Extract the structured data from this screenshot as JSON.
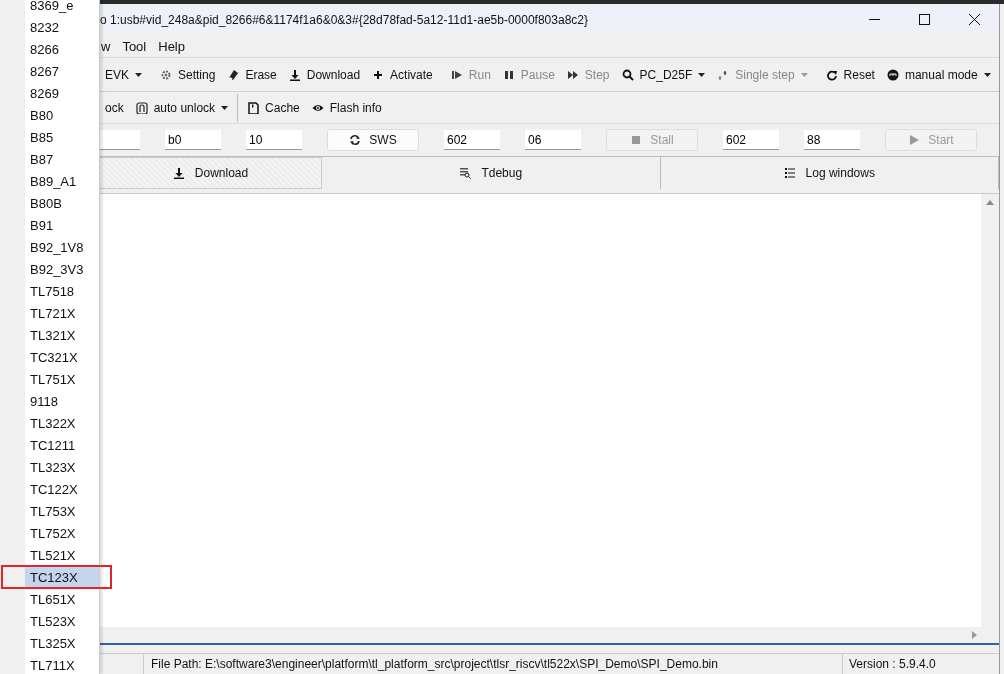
{
  "window": {
    "title": "o 1:usb#vid_248a&pid_8266#6&1174f1a6&0&3#{28d78fad-5a12-11d1-ae5b-0000f803a8c2}"
  },
  "menu": [
    "w",
    "Tool",
    "Help"
  ],
  "toolbar": [
    {
      "label": "EVK",
      "kind": "dropdown",
      "disabled": false
    },
    {
      "kind": "separator"
    },
    {
      "label": "Setting",
      "kind": "button",
      "disabled": false
    },
    {
      "label": "Erase",
      "kind": "button",
      "disabled": false
    },
    {
      "label": "Download",
      "kind": "button",
      "disabled": false
    },
    {
      "label": "Activate",
      "kind": "button",
      "disabled": false
    },
    {
      "kind": "separator"
    },
    {
      "label": "Run",
      "kind": "button",
      "disabled": true
    },
    {
      "label": "Pause",
      "kind": "button",
      "disabled": true
    },
    {
      "label": "Step",
      "kind": "button",
      "disabled": true
    },
    {
      "label": "PC_D25F",
      "kind": "dropdown",
      "disabled": false
    },
    {
      "label": "Single step",
      "kind": "dropdown",
      "disabled": true
    },
    {
      "kind": "separator"
    },
    {
      "label": "Reset",
      "kind": "button",
      "disabled": false
    },
    {
      "label": "manual mode",
      "kind": "dropdown",
      "disabled": false
    },
    {
      "kind": "separator"
    }
  ],
  "toolbar2": [
    {
      "label": "ock",
      "kind": "button"
    },
    {
      "label": "auto unlock",
      "kind": "dropdown"
    },
    {
      "kind": "separator"
    },
    {
      "label": "Cache",
      "kind": "button"
    },
    {
      "label": "Flash info",
      "kind": "button"
    }
  ],
  "fields": [
    {
      "kind": "field"
    },
    {
      "kind": "field",
      "value": "b0"
    },
    {
      "kind": "field",
      "value": "10"
    },
    {
      "kind": "button",
      "label": "SWS",
      "disabled": false
    },
    {
      "kind": "field",
      "value": "602"
    },
    {
      "kind": "field",
      "value": "06"
    },
    {
      "kind": "button",
      "label": "Stall",
      "disabled": true
    },
    {
      "kind": "field",
      "value": "602"
    },
    {
      "kind": "field",
      "value": "88"
    },
    {
      "kind": "button",
      "label": "Start",
      "disabled": true
    }
  ],
  "tabs": [
    {
      "label": "Download",
      "selected": true
    },
    {
      "label": "Tdebug",
      "selected": false
    },
    {
      "label": "Log windows",
      "selected": false
    }
  ],
  "status_bar": {
    "file_path": "File Path:  E:\\software3\\engineer\\platform\\tl_platform_src\\project\\tlsr_riscv\\tl522x\\SPI_Demo\\SPI_Demo.bin",
    "version": "Version : 5.9.4.0"
  },
  "dropdown": {
    "items": [
      {
        "label": "8369_e",
        "selected": false
      },
      {
        "label": "8232",
        "selected": false
      },
      {
        "label": "8266",
        "selected": false
      },
      {
        "label": "8267",
        "selected": false
      },
      {
        "label": "8269",
        "selected": false
      },
      {
        "label": "B80",
        "selected": false
      },
      {
        "label": "B85",
        "selected": false
      },
      {
        "label": "B87",
        "selected": false
      },
      {
        "label": "B89_A1",
        "selected": false
      },
      {
        "label": "B80B",
        "selected": false
      },
      {
        "label": "B91",
        "selected": false
      },
      {
        "label": "B92_1V8",
        "selected": false
      },
      {
        "label": "B92_3V3",
        "selected": false
      },
      {
        "label": "TL7518",
        "selected": false
      },
      {
        "label": "TL721X",
        "selected": false
      },
      {
        "label": "TL321X",
        "selected": false
      },
      {
        "label": "TC321X",
        "selected": false
      },
      {
        "label": "TL751X",
        "selected": false
      },
      {
        "label": "9118",
        "selected": false
      },
      {
        "label": "TL322X",
        "selected": false
      },
      {
        "label": "TC1211",
        "selected": false
      },
      {
        "label": "TL323X",
        "selected": false
      },
      {
        "label": "TC122X",
        "selected": false
      },
      {
        "label": "TL753X",
        "selected": false
      },
      {
        "label": "TL752X",
        "selected": false
      },
      {
        "label": "TL521X",
        "selected": false
      },
      {
        "label": "TC123X",
        "selected": true
      },
      {
        "label": "TL651X",
        "selected": false
      },
      {
        "label": "TL523X",
        "selected": false
      },
      {
        "label": "TL325X",
        "selected": false
      },
      {
        "label": "TL711X",
        "selected": false
      }
    ]
  }
}
